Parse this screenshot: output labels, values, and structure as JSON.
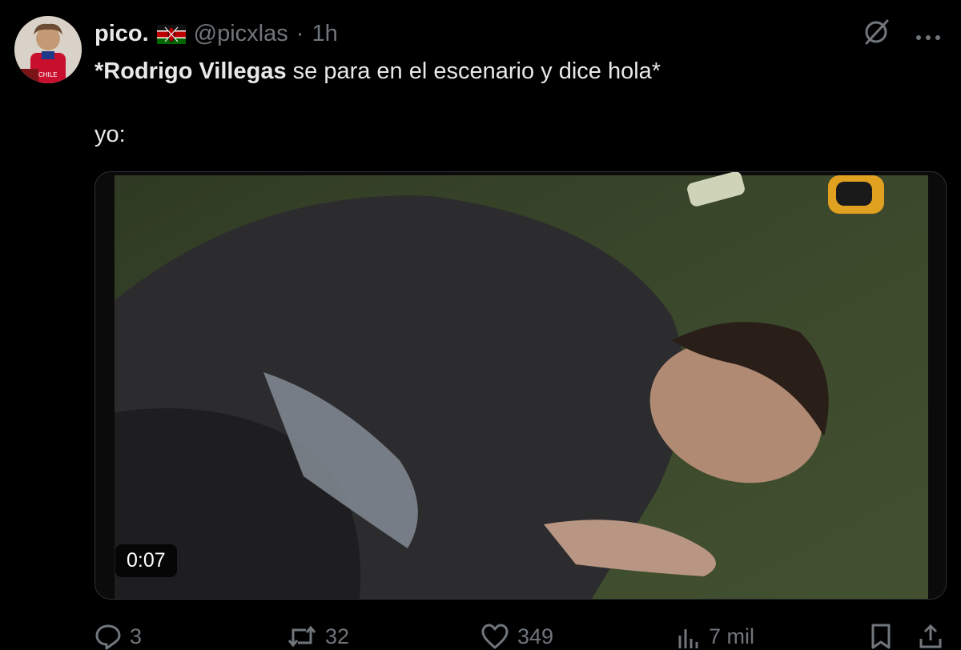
{
  "tweet": {
    "author_name": "pico.",
    "handle": "@picxlas",
    "separator": "·",
    "time": "1h",
    "text_bold": "*Rodrigo Villegas",
    "text_rest": " se para en el escenario y dice hola*",
    "text_line2": "yo:",
    "avatar_jersey_text": "CHILE"
  },
  "media": {
    "duration": "0:07"
  },
  "actions": {
    "replies": "3",
    "reposts": "32",
    "likes": "349",
    "views": "7 mil"
  },
  "colors": {
    "background": "#000000",
    "text": "#e7e9ea",
    "muted": "#71767b",
    "border": "#2f3336"
  },
  "icons": [
    "grok-icon",
    "more-icon",
    "reply-icon",
    "repost-icon",
    "like-icon",
    "views-icon",
    "bookmark-icon",
    "share-icon",
    "kenya-flag-icon"
  ]
}
